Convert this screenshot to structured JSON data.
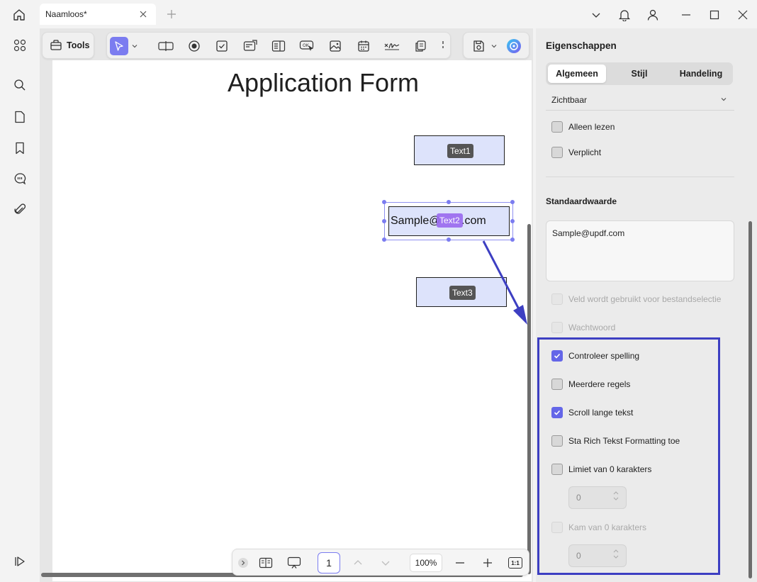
{
  "window": {
    "tab_title": "Naamloos*"
  },
  "left_toolbar": {
    "tools_label": "Tools"
  },
  "document": {
    "title": "Application Form",
    "fields": [
      {
        "tag": "Text1"
      },
      {
        "tag": "Text2",
        "value": "Sample@",
        "value_suffix": ".com"
      },
      {
        "tag": "Text3"
      }
    ]
  },
  "bottom_bar": {
    "page_number": "1",
    "zoom": "100%",
    "fit_label": "1:1"
  },
  "panel": {
    "title": "Eigenschappen",
    "tabs": [
      "Algemeen",
      "Stijl",
      "Handeling"
    ],
    "active_tab": "Algemeen",
    "visibility": "Zichtbaar",
    "read_only": "Alleen lezen",
    "required": "Verplicht",
    "default_value_title": "Standaardwaarde",
    "default_value": "Sample@updf.com",
    "file_select": "Veld wordt gebruikt voor bestandselectie",
    "password": "Wachtwoord",
    "spellcheck": "Controleer spelling",
    "multiline": "Meerdere regels",
    "scroll_long": "Scroll lange tekst",
    "rich_text": "Sta Rich Tekst Formatting toe",
    "limit_chars": "Limiet van 0 karakters",
    "limit_value": "0",
    "comb_chars": "Kam van 0 karakters",
    "comb_value": "0"
  },
  "colors": {
    "accent": "#7b7cf0",
    "checkbox_checked": "#6466e8",
    "annotation": "#3d3fc2",
    "field_fill": "#dde3fb"
  }
}
